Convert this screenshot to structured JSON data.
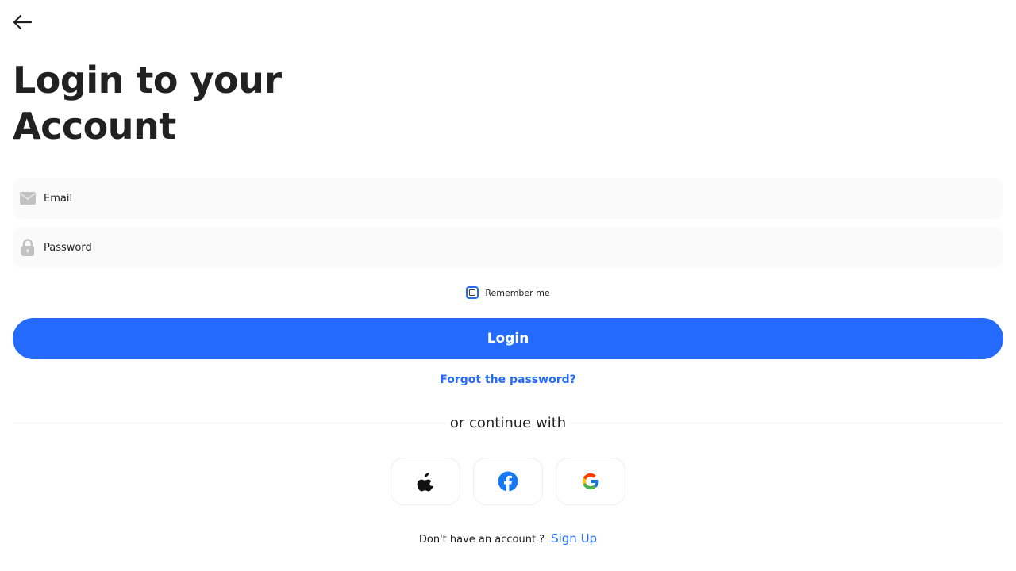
{
  "header": {
    "back_icon": "arrow-left-icon",
    "title_line1": "Login to your",
    "title_line2": "Account"
  },
  "form": {
    "email": {
      "icon": "envelope-icon",
      "placeholder": "Email",
      "value": ""
    },
    "password": {
      "icon": "lock-icon",
      "placeholder": "Password",
      "value": ""
    },
    "remember_label": "Remember me",
    "remember_checked": false,
    "login_label": "Login",
    "forgot_label": "Forgot the password?"
  },
  "social": {
    "divider_label": "or continue with",
    "providers": [
      {
        "name": "apple",
        "icon": "apple-icon"
      },
      {
        "name": "facebook",
        "icon": "facebook-icon"
      },
      {
        "name": "google",
        "icon": "google-icon"
      }
    ]
  },
  "footer": {
    "prompt": "Don't have an account ?",
    "signup_label": "Sign Up"
  },
  "colors": {
    "primary": "#246bfd",
    "field_background": "#fafafa",
    "text": "#212121",
    "icon_muted": "#c2c2c2"
  }
}
